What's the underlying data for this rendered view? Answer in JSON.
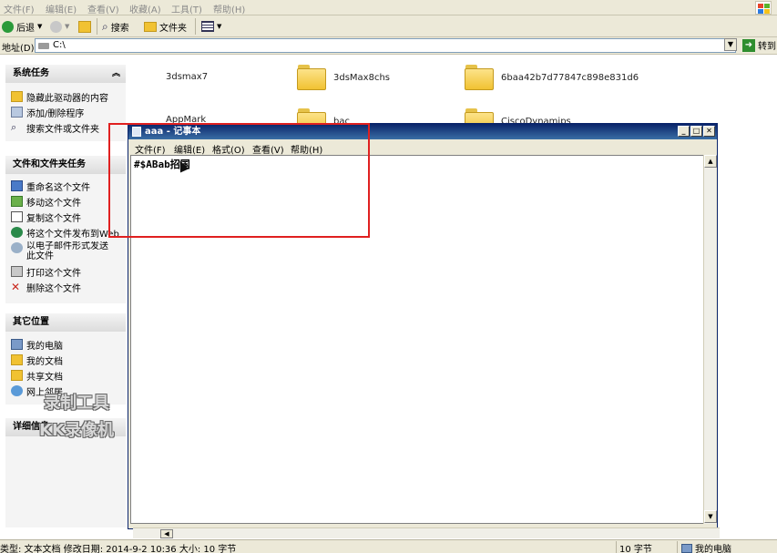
{
  "menubar": {
    "items": [
      "文件(F)",
      "编辑(E)",
      "查看(V)",
      "收藏(A)",
      "工具(T)",
      "帮助(H)"
    ]
  },
  "toolbar": {
    "back_label": "后退",
    "search_label": "搜索",
    "folders_label": "文件夹"
  },
  "address": {
    "label": "地址(D)",
    "value": "C:\\",
    "go_label": "转到"
  },
  "left_pane": {
    "system_tasks": {
      "title": "系统任务",
      "items": [
        "隐藏此驱动器的内容",
        "添加/删除程序",
        "搜索文件或文件夹"
      ]
    },
    "file_tasks": {
      "title": "文件和文件夹任务",
      "items": [
        "重命名这个文件",
        "移动这个文件",
        "复制这个文件",
        "将这个文件发布到Web",
        "以电子邮件形式发送此文件",
        "打印这个文件",
        "删除这个文件"
      ]
    },
    "other_places": {
      "title": "其它位置",
      "items": [
        "我的电脑",
        "我的文档",
        "共享文档",
        "网上邻居"
      ]
    },
    "details": {
      "title": "详细信息"
    },
    "watermark": {
      "line1": "录制工具",
      "line2": "KK录像机"
    }
  },
  "files": [
    {
      "name": "3dsmax7"
    },
    {
      "name": "3dsMax8chs"
    },
    {
      "name": "6baa42b7d77847c898e831d6"
    },
    {
      "name": "AppMark"
    },
    {
      "name": "bac"
    },
    {
      "name": "CiscoDynamips"
    }
  ],
  "notepad": {
    "title": "aaa - 记事本",
    "menu": [
      "文件(F)",
      "编辑(E)",
      "格式(O)",
      "查看(V)",
      "帮助(H)"
    ],
    "content": "#$ABab招国"
  },
  "statusbar": {
    "info": "类型: 文本文档 修改日期: 2014-9-2 10:36 大小: 10 字节",
    "size": "10 字节",
    "location": "我的电脑"
  },
  "colors": {
    "title_bar": "#0a246a",
    "highlight_box": "#e02020"
  }
}
